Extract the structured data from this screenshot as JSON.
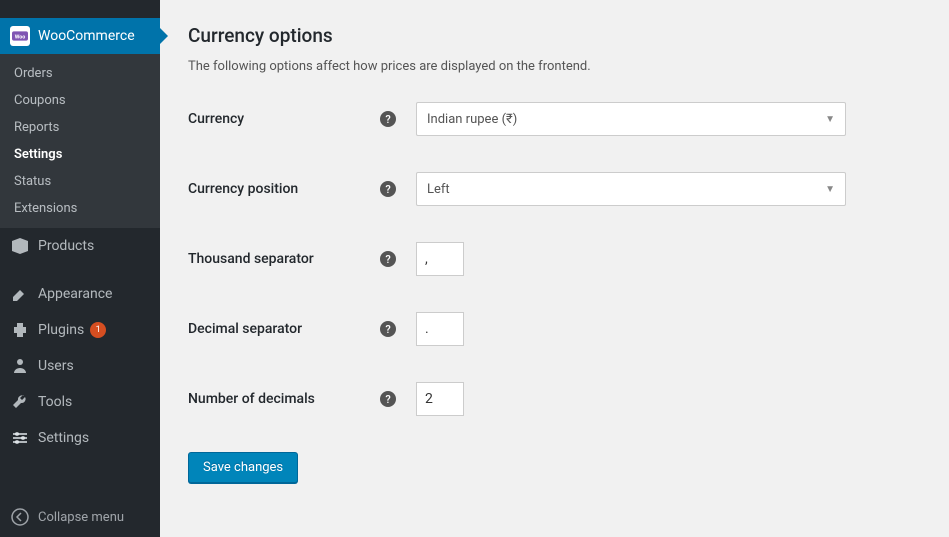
{
  "sidebar": {
    "active": {
      "label": "WooCommerce"
    },
    "subnav": [
      {
        "label": "Orders"
      },
      {
        "label": "Coupons"
      },
      {
        "label": "Reports"
      },
      {
        "label": "Settings"
      },
      {
        "label": "Status"
      },
      {
        "label": "Extensions"
      }
    ],
    "nav": [
      {
        "label": "Products"
      },
      {
        "label": "Appearance"
      },
      {
        "label": "Plugins",
        "badge": "1"
      },
      {
        "label": "Users"
      },
      {
        "label": "Tools"
      },
      {
        "label": "Settings"
      }
    ],
    "collapse": "Collapse menu"
  },
  "main": {
    "title": "Currency options",
    "description": "The following options affect how prices are displayed on the frontend.",
    "fields": {
      "currency": {
        "label": "Currency",
        "value": "Indian rupee (₹)"
      },
      "position": {
        "label": "Currency position",
        "value": "Left"
      },
      "thousand": {
        "label": "Thousand separator",
        "value": ","
      },
      "decimal": {
        "label": "Decimal separator",
        "value": "."
      },
      "decimals": {
        "label": "Number of decimals",
        "value": "2"
      }
    },
    "save": "Save changes"
  }
}
